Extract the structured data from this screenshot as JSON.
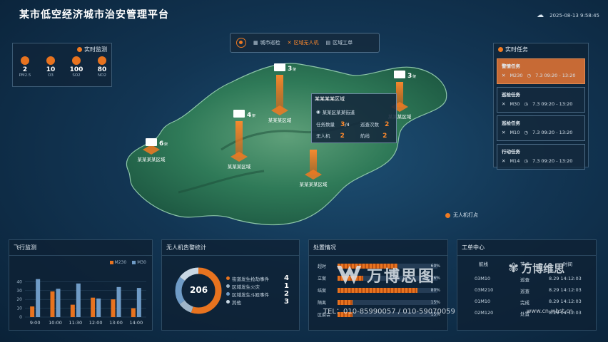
{
  "header": {
    "title": "某市低空经济城市治安管理平台",
    "datetime": "2025-08-13 9:58:45",
    "weather_icon": "cloud-icon"
  },
  "nav": {
    "items": [
      {
        "label": "城市巡检",
        "icon": "building-icon",
        "active": false
      },
      {
        "label": "区域无人机",
        "icon": "drone-icon",
        "active": true
      },
      {
        "label": "区域工单",
        "icon": "doc-icon",
        "active": false
      }
    ]
  },
  "air_quality": {
    "title": "实时监测",
    "items": [
      {
        "value": "2",
        "label": "PM2.5"
      },
      {
        "value": "10",
        "label": "O3"
      },
      {
        "value": "100",
        "label": "SO2"
      },
      {
        "value": "80",
        "label": "NO2"
      }
    ]
  },
  "map": {
    "markers": [
      {
        "label": "某某某某区域",
        "count": "6",
        "unit": "架"
      },
      {
        "label": "某某某区域",
        "count": "4",
        "unit": "架"
      },
      {
        "label": "某某某区域",
        "count": "3",
        "unit": "架"
      },
      {
        "label": "某某某某区域",
        "count": "",
        "unit": ""
      },
      {
        "label": "某某某区域",
        "count": "3",
        "unit": "架"
      }
    ],
    "popup": {
      "title": "某某某某区域",
      "address": "某某区某某街道",
      "task_label": "任务数量",
      "task_value": "3",
      "task_total": "/4",
      "inspect_label": "巡查次数",
      "inspect_value": "2",
      "uav_label": "无人机",
      "uav_value": "2",
      "route_label": "航线",
      "route_value": "2"
    },
    "legend": "无人机打点"
  },
  "tasks": {
    "title": "实时任务",
    "items": [
      {
        "name": "警情任务",
        "drone": "M230",
        "time": "7.3  09:20 - 13:20",
        "active": true
      },
      {
        "name": "巡检任务",
        "drone": "M30",
        "time": "7.3  09:20 - 13:20",
        "active": false
      },
      {
        "name": "巡检任务",
        "drone": "M10",
        "time": "7.3  09:20 - 13:20",
        "active": false
      },
      {
        "name": "行动任务",
        "drone": "M14",
        "time": "7.3  09:20 - 13:20",
        "active": false
      }
    ]
  },
  "flight": {
    "title": "飞行监测",
    "legend": [
      "M230",
      "M30"
    ],
    "colors": {
      "M230": "#e8731f",
      "M30": "#6f9bc6"
    }
  },
  "chart_data": {
    "type": "bar",
    "categories": [
      "9:00",
      "10:00",
      "11:30",
      "12:00",
      "13:00",
      "14:00"
    ],
    "series": [
      {
        "name": "M230",
        "values": [
          12,
          29,
          14,
          22,
          20,
          10
        ]
      },
      {
        "name": "M30",
        "values": [
          43,
          32,
          38,
          21,
          34,
          33
        ]
      }
    ],
    "y_ticks": [
      "0",
      "10",
      "20",
      "30",
      "40"
    ],
    "ylim": [
      0,
      50
    ]
  },
  "uav_stats": {
    "title": "无人机告警统计",
    "total": "206",
    "items": [
      {
        "label": "街道发生抢劫事件",
        "value": "4",
        "color": "#e8731f"
      },
      {
        "label": "区域发生火灾",
        "value": "1",
        "color": "#9fb5c8"
      },
      {
        "label": "区域发生斗殴事件",
        "value": "2",
        "color": "#6f9bc6"
      },
      {
        "label": "其他",
        "value": "3",
        "color": "#c9d8e4"
      }
    ],
    "donut": [
      0.55,
      0.1,
      0.2,
      0.15
    ]
  },
  "handling": {
    "title": "处置情况",
    "rows": [
      {
        "label": "超时",
        "pct": "60%",
        "value": 0.6
      },
      {
        "label": "立案",
        "pct": "26%",
        "value": 0.26
      },
      {
        "label": "结案",
        "pct": "80%",
        "value": 0.8
      },
      {
        "label": "隔离",
        "pct": "15%",
        "value": 0.15
      },
      {
        "label": "区委会",
        "pct": "15%",
        "value": 0.15
      }
    ]
  },
  "workorder": {
    "title": "工单中心",
    "headers": [
      "航线",
      "节点",
      "时间"
    ],
    "rows": [
      {
        "route": "03M10",
        "node": "巡查",
        "time": "8.29 14:12:03"
      },
      {
        "route": "03M210",
        "node": "巡查",
        "time": "8.29 14:12:03"
      },
      {
        "route": "01M10",
        "node": "完成",
        "time": "8.29 14:12:03"
      },
      {
        "route": "02M120",
        "node": "处置",
        "time": "8.29 14:12:03"
      }
    ]
  },
  "watermark": {
    "brand": "万博思图",
    "tel": "TEL：010-85990057 / 010-59070059",
    "brand2": "万博维思",
    "url": "www.cn-wbst.cn"
  }
}
